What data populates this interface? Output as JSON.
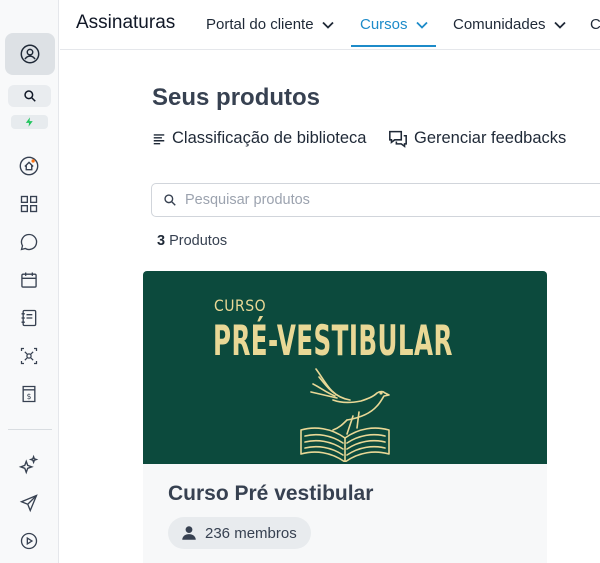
{
  "topbar": {
    "brand": "Assinaturas",
    "nav": [
      {
        "label": "Portal do cliente",
        "has_chevron": true,
        "active": false
      },
      {
        "label": "Cursos",
        "has_chevron": true,
        "active": true
      },
      {
        "label": "Comunidades",
        "has_chevron": true,
        "active": false
      },
      {
        "label": "C",
        "has_chevron": false,
        "active": false
      }
    ],
    "accent_color": "#1d8bc9"
  },
  "sidebar": {
    "icons": [
      "user-circle-icon",
      "search-icon",
      "bolt-icon",
      "home-icon",
      "grid-icon",
      "chat-icon",
      "calendar-icon",
      "notebook-icon",
      "network-icon",
      "invoice-icon",
      "sparkles-icon",
      "send-icon",
      "play-circle-icon"
    ],
    "bolt_color": "#22c55e"
  },
  "main": {
    "title": "Seus produtos",
    "actions": {
      "library_sort": "Classificação de biblioteca",
      "manage_feedback": "Gerenciar feedbacks"
    },
    "search": {
      "placeholder": "Pesquisar produtos"
    },
    "count": {
      "number": "3",
      "label": "Produtos"
    }
  },
  "products": [
    {
      "banner_kicker": "CURSO",
      "banner_title": "PRÉ-VESTIBULAR",
      "banner_color": "#0c4a3d",
      "banner_text_color": "#e9d896",
      "name": "Curso Pré vestibular",
      "members": "236 membros"
    }
  ]
}
